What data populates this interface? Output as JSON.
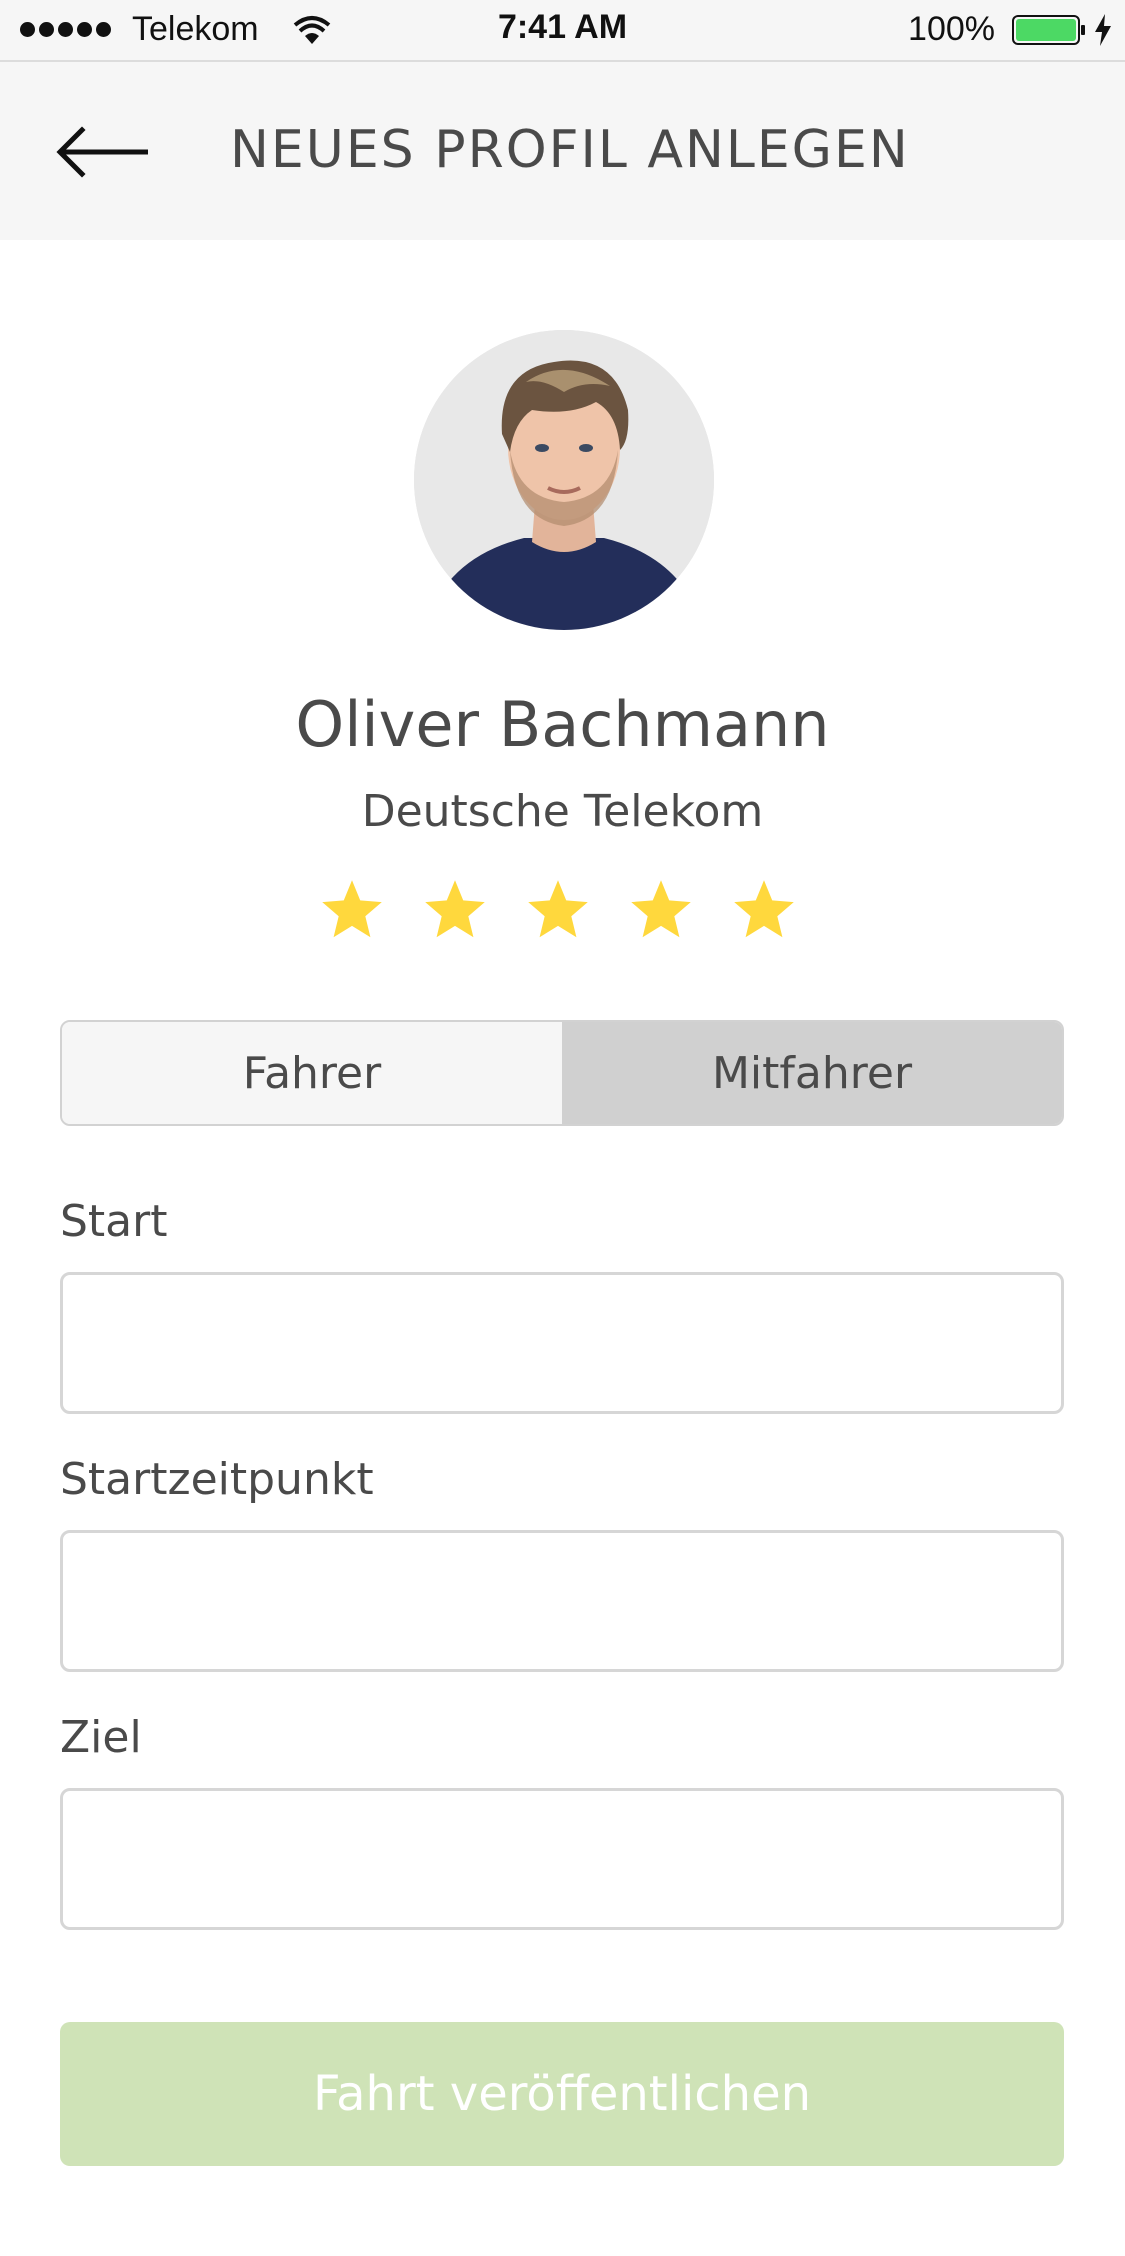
{
  "status_bar": {
    "carrier": "Telekom",
    "time": "7:41 AM",
    "battery_percent": "100%",
    "icons": [
      "signal-dots-icon",
      "wifi-icon",
      "battery-icon",
      "charging-bolt-icon"
    ]
  },
  "header": {
    "title": "NEUES PROFIL ANLEGEN",
    "back_icon": "back-arrow-icon"
  },
  "profile": {
    "name": "Oliver Bachmann",
    "company": "Deutsche Telekom",
    "rating": 5,
    "rating_max": 5,
    "star_color": "#ffd83d"
  },
  "role_toggle": {
    "options": [
      {
        "label": "Fahrer",
        "selected": false
      },
      {
        "label": "Mitfahrer",
        "selected": true
      }
    ]
  },
  "form": {
    "start": {
      "label": "Start",
      "value": "",
      "placeholder": ""
    },
    "start_time": {
      "label": "Startzeitpunkt",
      "value": "",
      "placeholder": ""
    },
    "destination": {
      "label": "Ziel",
      "value": "",
      "placeholder": ""
    }
  },
  "submit": {
    "label": "Fahrt veröffentlichen",
    "color": "#cfe3b7"
  },
  "colors": {
    "header_bg": "#f6f6f6",
    "text": "#4a4a4a",
    "toggle_selected": "#d0d0d0",
    "battery": "#4cd964"
  }
}
